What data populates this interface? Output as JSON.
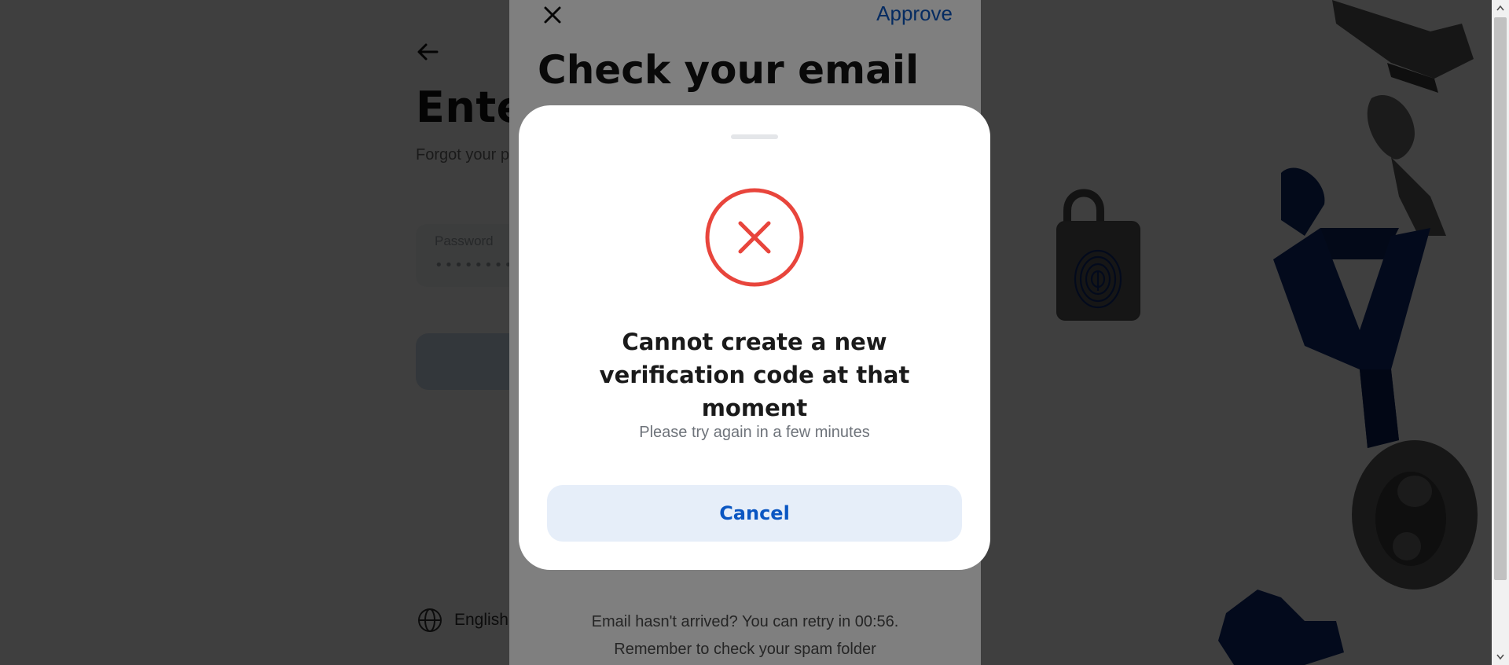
{
  "login": {
    "title": "Enter your password",
    "forgot_text": "Forgot your password?",
    "password_label": "Password",
    "password_value": "••••••••••",
    "language": "English"
  },
  "email_sheet": {
    "approve_label": "Approve",
    "title": "Check your email on this device",
    "footer_line1": "Email hasn't arrived? You can retry in 00:56.",
    "footer_line2": "Remember to check your spam folder"
  },
  "modal": {
    "title": "Cannot create a new verification code at that moment",
    "message": "Please try again in a few minutes",
    "cancel_label": "Cancel"
  },
  "icons": {
    "back": "back-arrow-icon",
    "close": "close-icon",
    "error": "error-circle-x-icon",
    "globe": "globe-icon"
  },
  "colors": {
    "accent": "#0a56c2",
    "error": "#e8453c",
    "cancel_bg": "#e6eef9"
  }
}
